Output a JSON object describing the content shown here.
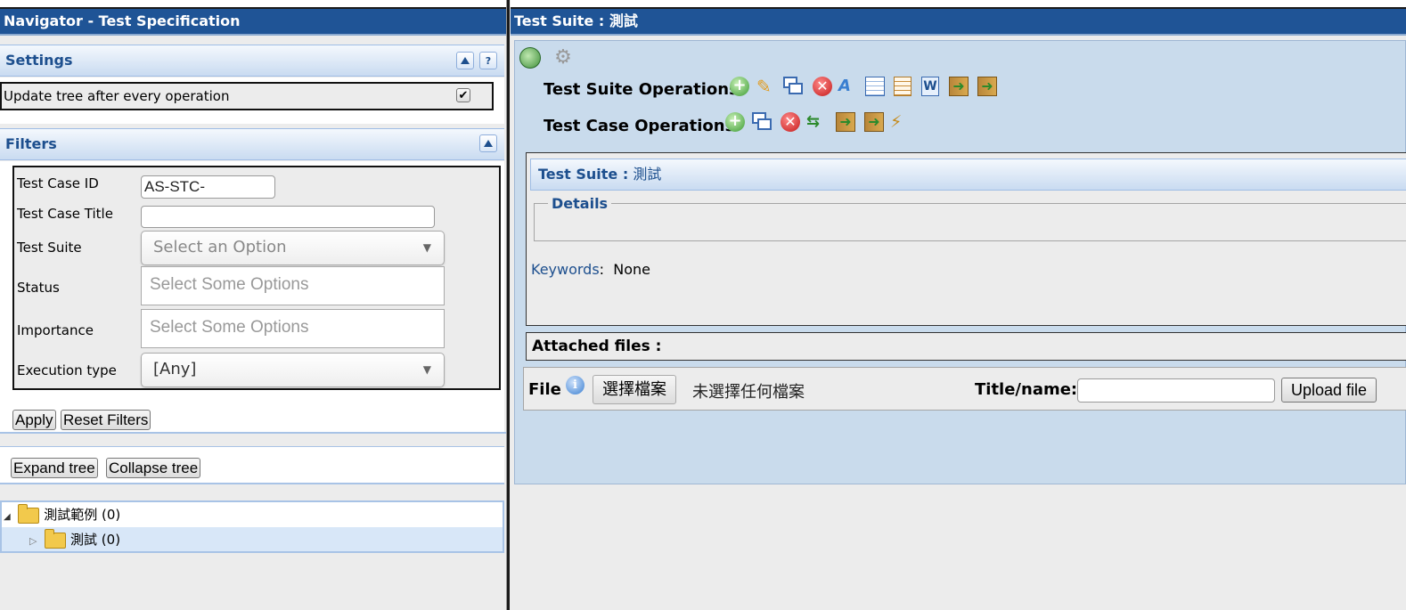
{
  "navigator": {
    "title": "Navigator - Test Specification",
    "settings": {
      "header": "Settings",
      "update_tree_label": "Update tree after every operation",
      "update_tree_checked": true,
      "collapse_icon": "triangle-up-icon",
      "help_icon": "question-icon"
    },
    "filters": {
      "header": "Filters",
      "test_case_id": {
        "label": "Test Case ID",
        "value": "AS-STC-"
      },
      "test_case_title": {
        "label": "Test Case Title",
        "value": ""
      },
      "test_suite": {
        "label": "Test Suite",
        "placeholder": "Select an Option"
      },
      "status": {
        "label": "Status",
        "placeholder": "Select Some Options"
      },
      "importance": {
        "label": "Importance",
        "placeholder": "Select Some Options"
      },
      "execution_type": {
        "label": "Execution type",
        "value": "[Any]"
      },
      "apply_label": "Apply",
      "reset_label": "Reset Filters"
    },
    "tree_buttons": {
      "expand_label": "Expand tree",
      "collapse_label": "Collapse tree"
    },
    "tree": [
      {
        "label": "測試範例 (0)",
        "expanded": true
      },
      {
        "label": "測試 (0)",
        "expanded": false,
        "selected": true
      }
    ]
  },
  "main": {
    "title": "Test Suite : 測試",
    "suite_ops_label": "Test Suite Operations",
    "case_ops_label": "Test Case Operations",
    "suite_ops_icons": [
      "add-icon",
      "edit-pencil-icon",
      "copy-windows-icon",
      "delete-icon",
      "translate-icon",
      "table-icon",
      "report-icon",
      "word-export-icon",
      "import-icon",
      "export-icon"
    ],
    "case_ops_icons": [
      "add-icon",
      "copy-windows-icon",
      "delete-icon",
      "move-arrows-icon",
      "import-icon",
      "export-icon",
      "magic-wand-icon"
    ],
    "detail_panel": {
      "header_prefix": "Test Suite :",
      "header_name": "測試",
      "details_legend": "Details",
      "keywords_label": "Keywords",
      "keywords_value": "None"
    },
    "attached_files": {
      "header": "Attached files :",
      "file_label": "File",
      "choose_label": "選擇檔案",
      "no_file_text": "未選擇任何檔案",
      "title_label": "Title/name:",
      "title_value": "",
      "upload_label": "Upload file"
    }
  },
  "colors": {
    "title_bar": "#1f5496",
    "section_text": "#1d4f8e",
    "panel_bg": "#c9dbec",
    "selected_row": "#d8e7f8"
  }
}
